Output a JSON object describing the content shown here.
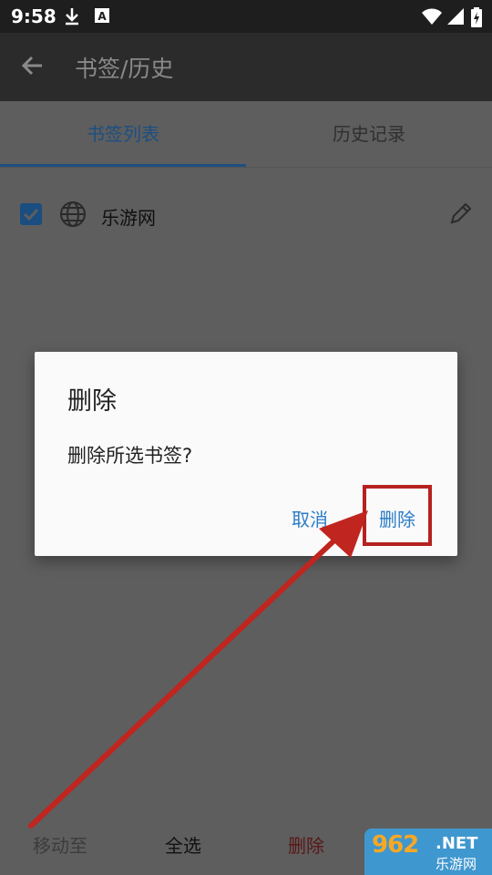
{
  "status_bar": {
    "time": "9:58",
    "icons": [
      "download-icon",
      "a-badge-icon",
      "wifi-icon",
      "signal-icon",
      "battery-icon"
    ]
  },
  "app_bar": {
    "back_icon": "arrow-left-icon",
    "title": "书签/历史"
  },
  "tabs": [
    {
      "label": "书签列表",
      "active": true
    },
    {
      "label": "历史记录",
      "active": false
    }
  ],
  "bookmarks": [
    {
      "checked": true,
      "icon": "globe-icon",
      "label": "乐游网",
      "edit_icon": "pencil-icon"
    }
  ],
  "dialog": {
    "title": "删除",
    "message": "删除所选书签?",
    "cancel_label": "取消",
    "confirm_label": "删除"
  },
  "bottom_bar": {
    "move_label": "移动至",
    "select_all_label": "全选",
    "delete_label": "删除"
  },
  "watermark": {
    "logo": "962",
    "net": ".NET",
    "text": "乐游网"
  },
  "colors": {
    "accent": "#1d4f82",
    "dialog_button": "#2a7cc7",
    "annotation_red": "#b5221f"
  }
}
